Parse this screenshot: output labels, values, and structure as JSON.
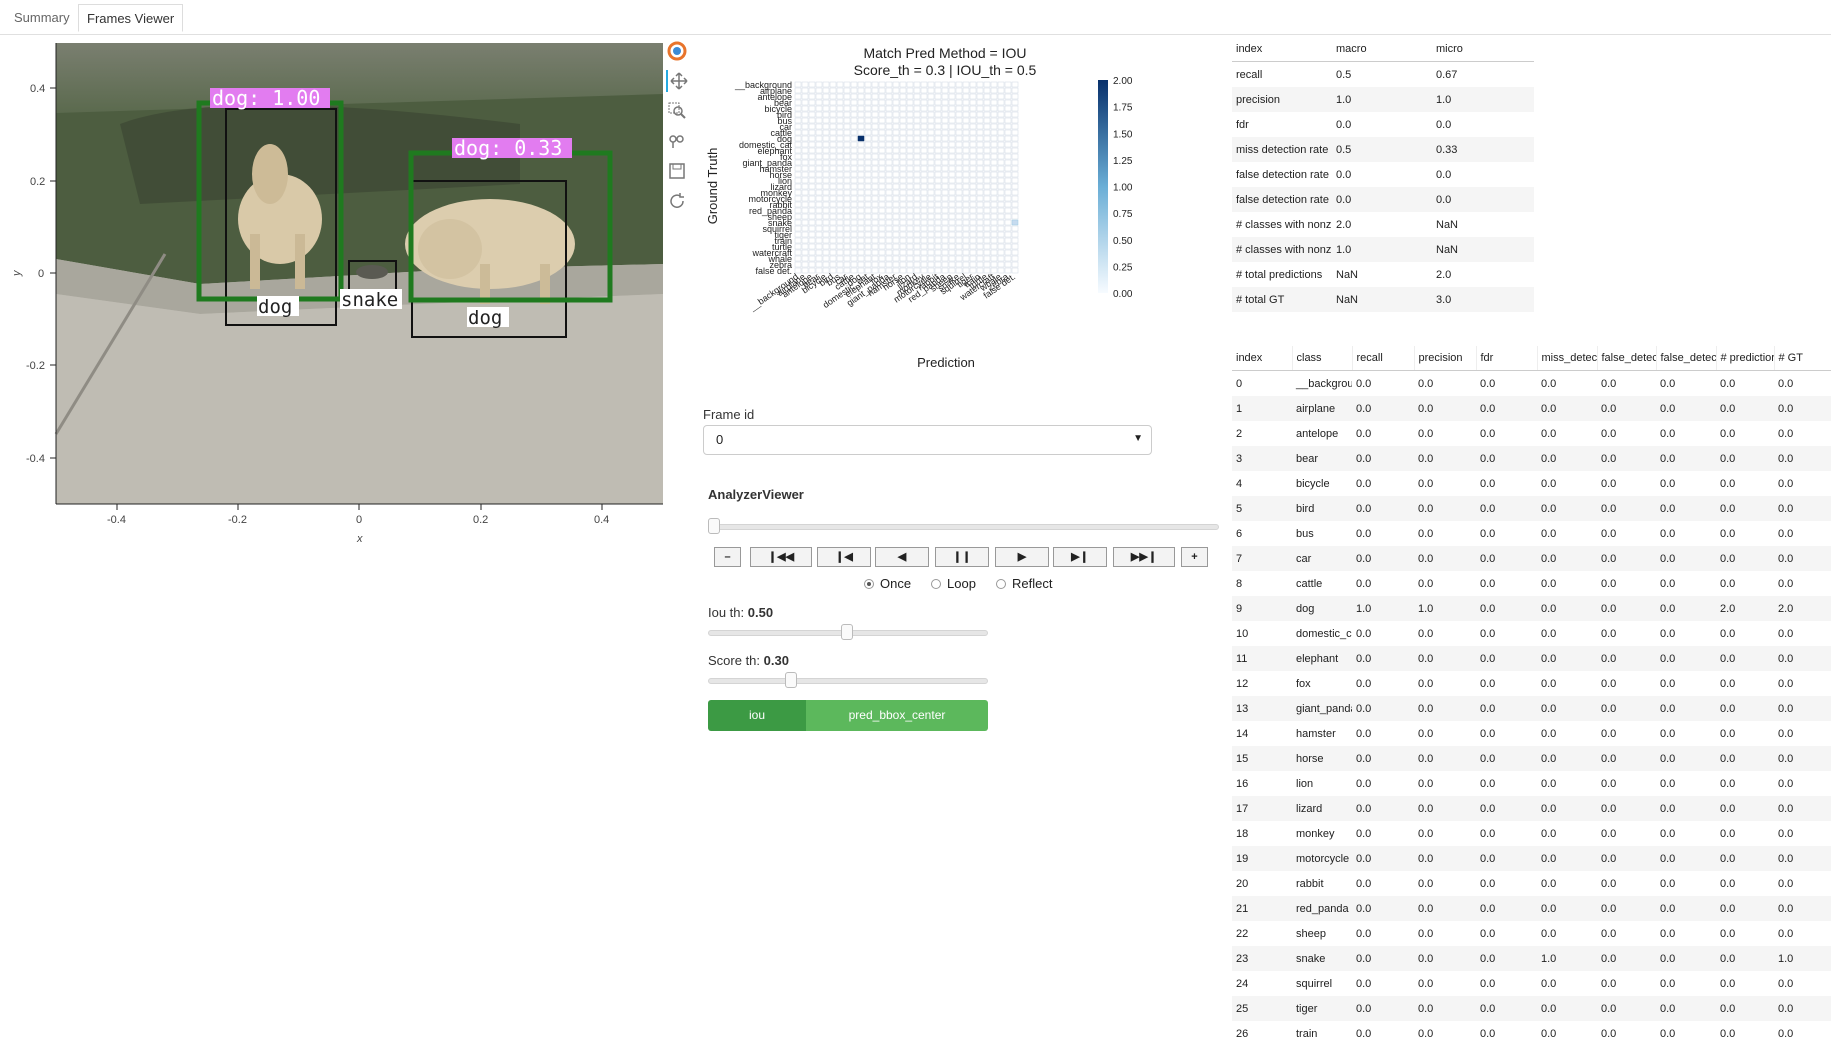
{
  "tabs": [
    {
      "label": "Summary",
      "active": false
    },
    {
      "label": "Frames Viewer",
      "active": true
    }
  ],
  "image_plot": {
    "x_label": "x",
    "y_label": "y",
    "x_ticks": [
      "-0.4",
      "-0.2",
      "0",
      "0.2",
      "0.4"
    ],
    "y_ticks": [
      "0.4",
      "0.2",
      "0",
      "-0.2",
      "-0.4"
    ],
    "pred_labels": [
      "dog: 1.00",
      "dog: 0.33"
    ],
    "gt_labels": [
      "dog",
      "snake",
      "dog"
    ],
    "colors": {
      "pred_box": "#1f7a1f",
      "pred_label_bg": "#e27cf0",
      "gt_box": "#111111"
    }
  },
  "toolbar": {
    "tools": [
      "bokeh-logo-icon",
      "pan-icon",
      "box-zoom-icon",
      "wheel-zoom-icon",
      "save-icon",
      "reset-icon"
    ]
  },
  "heatmap": {
    "title_line1": "Match Pred Method = IOU",
    "title_line2": "Score_th = 0.3 | IOU_th = 0.5",
    "ylabel": "Ground Truth",
    "xlabel": "Prediction",
    "classes": [
      "__background",
      "airplane",
      "antelope",
      "bear",
      "bicycle",
      "bird",
      "bus",
      "car",
      "cattle",
      "dog",
      "domestic_cat",
      "elephant",
      "fox",
      "giant_panda",
      "hamster",
      "horse",
      "lion",
      "lizard",
      "monkey",
      "motorcycle",
      "rabbit",
      "red_panda",
      "sheep",
      "snake",
      "squirrel",
      "tiger",
      "train",
      "turtle",
      "watercraft",
      "whale",
      "zebra",
      "false det."
    ],
    "colorbar_ticks": [
      "2.00",
      "1.75",
      "1.50",
      "1.25",
      "1.00",
      "0.75",
      "0.50",
      "0.25",
      "0.00"
    ]
  },
  "frame_select": {
    "label": "Frame id",
    "value": "0"
  },
  "player": {
    "title": "AnalyzerViewer",
    "buttons": [
      "–",
      "❙◀◀",
      "❙◀",
      "◀",
      "❙❙",
      "▶",
      "▶❙",
      "▶▶❙",
      "+"
    ],
    "modes": [
      "Once",
      "Loop",
      "Reflect"
    ],
    "selected_mode": "Once",
    "position": 0
  },
  "iou_slider": {
    "label": "Iou th: ",
    "value": "0.50",
    "level": 0.5
  },
  "score_slider": {
    "label": "Score th: ",
    "value": "0.30",
    "level": 0.3
  },
  "method_buttons": {
    "iou": "iou",
    "pred": "pred_bbox_center"
  },
  "summary_table": {
    "columns": [
      "index",
      "macro",
      "micro"
    ],
    "rows": [
      [
        "recall",
        "0.5",
        "0.67"
      ],
      [
        "precision",
        "1.0",
        "1.0"
      ],
      [
        "fdr",
        "0.0",
        "0.0"
      ],
      [
        "miss detection rate",
        "0.5",
        "0.33"
      ],
      [
        "false detection rate",
        "0.0",
        "0.0"
      ],
      [
        "false detection rate",
        "0.0",
        "0.0"
      ],
      [
        "# classes with nonz",
        "2.0",
        "NaN"
      ],
      [
        "# classes with nonz",
        "1.0",
        "NaN"
      ],
      [
        "# total predictions",
        "NaN",
        "2.0"
      ],
      [
        "# total GT",
        "NaN",
        "3.0"
      ]
    ]
  },
  "class_table": {
    "columns": [
      "index",
      "class",
      "recall",
      "precision",
      "fdr",
      "miss_detec",
      "false_detec",
      "false_detec",
      "# predictior",
      "# GT"
    ],
    "rows": [
      [
        "0",
        "__backgrou",
        "0.0",
        "0.0",
        "0.0",
        "0.0",
        "0.0",
        "0.0",
        "0.0",
        "0.0"
      ],
      [
        "1",
        "airplane",
        "0.0",
        "0.0",
        "0.0",
        "0.0",
        "0.0",
        "0.0",
        "0.0",
        "0.0"
      ],
      [
        "2",
        "antelope",
        "0.0",
        "0.0",
        "0.0",
        "0.0",
        "0.0",
        "0.0",
        "0.0",
        "0.0"
      ],
      [
        "3",
        "bear",
        "0.0",
        "0.0",
        "0.0",
        "0.0",
        "0.0",
        "0.0",
        "0.0",
        "0.0"
      ],
      [
        "4",
        "bicycle",
        "0.0",
        "0.0",
        "0.0",
        "0.0",
        "0.0",
        "0.0",
        "0.0",
        "0.0"
      ],
      [
        "5",
        "bird",
        "0.0",
        "0.0",
        "0.0",
        "0.0",
        "0.0",
        "0.0",
        "0.0",
        "0.0"
      ],
      [
        "6",
        "bus",
        "0.0",
        "0.0",
        "0.0",
        "0.0",
        "0.0",
        "0.0",
        "0.0",
        "0.0"
      ],
      [
        "7",
        "car",
        "0.0",
        "0.0",
        "0.0",
        "0.0",
        "0.0",
        "0.0",
        "0.0",
        "0.0"
      ],
      [
        "8",
        "cattle",
        "0.0",
        "0.0",
        "0.0",
        "0.0",
        "0.0",
        "0.0",
        "0.0",
        "0.0"
      ],
      [
        "9",
        "dog",
        "1.0",
        "1.0",
        "0.0",
        "0.0",
        "0.0",
        "0.0",
        "2.0",
        "2.0"
      ],
      [
        "10",
        "domestic_c",
        "0.0",
        "0.0",
        "0.0",
        "0.0",
        "0.0",
        "0.0",
        "0.0",
        "0.0"
      ],
      [
        "11",
        "elephant",
        "0.0",
        "0.0",
        "0.0",
        "0.0",
        "0.0",
        "0.0",
        "0.0",
        "0.0"
      ],
      [
        "12",
        "fox",
        "0.0",
        "0.0",
        "0.0",
        "0.0",
        "0.0",
        "0.0",
        "0.0",
        "0.0"
      ],
      [
        "13",
        "giant_panda",
        "0.0",
        "0.0",
        "0.0",
        "0.0",
        "0.0",
        "0.0",
        "0.0",
        "0.0"
      ],
      [
        "14",
        "hamster",
        "0.0",
        "0.0",
        "0.0",
        "0.0",
        "0.0",
        "0.0",
        "0.0",
        "0.0"
      ],
      [
        "15",
        "horse",
        "0.0",
        "0.0",
        "0.0",
        "0.0",
        "0.0",
        "0.0",
        "0.0",
        "0.0"
      ],
      [
        "16",
        "lion",
        "0.0",
        "0.0",
        "0.0",
        "0.0",
        "0.0",
        "0.0",
        "0.0",
        "0.0"
      ],
      [
        "17",
        "lizard",
        "0.0",
        "0.0",
        "0.0",
        "0.0",
        "0.0",
        "0.0",
        "0.0",
        "0.0"
      ],
      [
        "18",
        "monkey",
        "0.0",
        "0.0",
        "0.0",
        "0.0",
        "0.0",
        "0.0",
        "0.0",
        "0.0"
      ],
      [
        "19",
        "motorcycle",
        "0.0",
        "0.0",
        "0.0",
        "0.0",
        "0.0",
        "0.0",
        "0.0",
        "0.0"
      ],
      [
        "20",
        "rabbit",
        "0.0",
        "0.0",
        "0.0",
        "0.0",
        "0.0",
        "0.0",
        "0.0",
        "0.0"
      ],
      [
        "21",
        "red_panda",
        "0.0",
        "0.0",
        "0.0",
        "0.0",
        "0.0",
        "0.0",
        "0.0",
        "0.0"
      ],
      [
        "22",
        "sheep",
        "0.0",
        "0.0",
        "0.0",
        "0.0",
        "0.0",
        "0.0",
        "0.0",
        "0.0"
      ],
      [
        "23",
        "snake",
        "0.0",
        "0.0",
        "0.0",
        "1.0",
        "0.0",
        "0.0",
        "0.0",
        "1.0"
      ],
      [
        "24",
        "squirrel",
        "0.0",
        "0.0",
        "0.0",
        "0.0",
        "0.0",
        "0.0",
        "0.0",
        "0.0"
      ],
      [
        "25",
        "tiger",
        "0.0",
        "0.0",
        "0.0",
        "0.0",
        "0.0",
        "0.0",
        "0.0",
        "0.0"
      ],
      [
        "26",
        "train",
        "0.0",
        "0.0",
        "0.0",
        "0.0",
        "0.0",
        "0.0",
        "0.0",
        "0.0"
      ]
    ]
  }
}
